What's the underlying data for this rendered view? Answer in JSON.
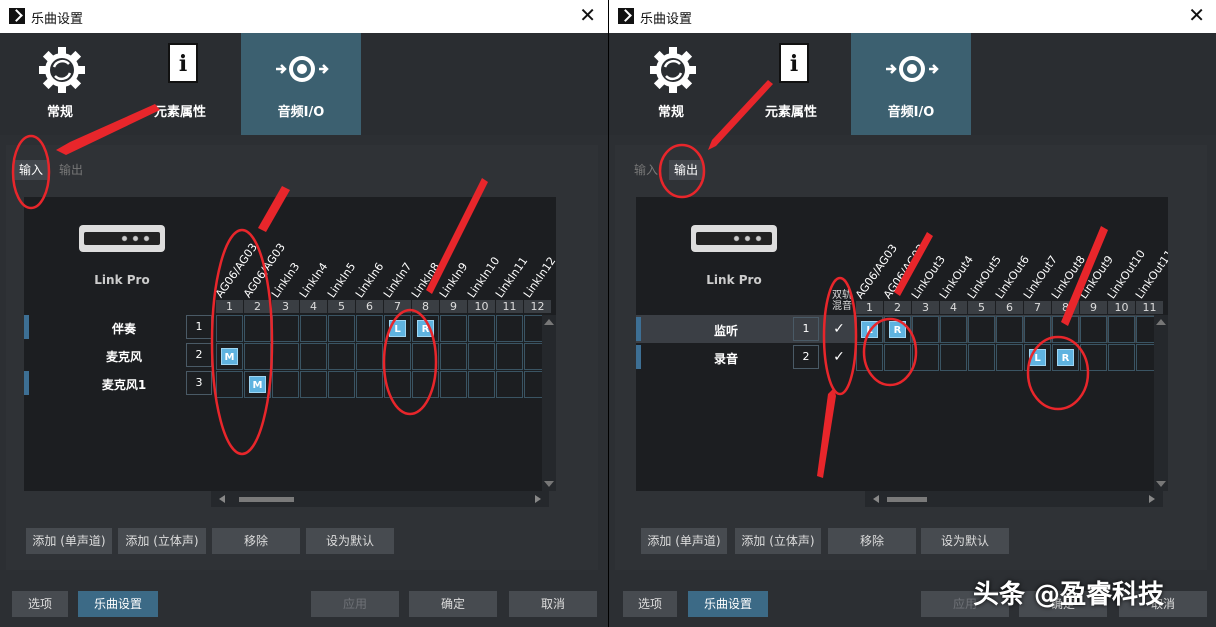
{
  "watermark": "头条 @盈睿科技",
  "left": {
    "title": "乐曲设置",
    "tabs": {
      "general": "常规",
      "properties": "元素属性",
      "audio_io": "音频I/O"
    },
    "subtabs": [
      "输入",
      "输出"
    ],
    "device": "Link Pro",
    "columns": [
      "AG06/AG03",
      "AG06/AG03",
      "LinkIn3",
      "LinkIn4",
      "LinkIn5",
      "LinkIn6",
      "LinkIn7",
      "LinkIn8",
      "LinkIn9",
      "LinkIn10",
      "LinkIn11",
      "LinkIn12"
    ],
    "col_numbers": [
      "1",
      "2",
      "3",
      "4",
      "5",
      "6",
      "7",
      "8",
      "9",
      "10",
      "11",
      "12"
    ],
    "rows": [
      {
        "label": "伴奏",
        "num": "1"
      },
      {
        "label": "麦克风",
        "num": "2"
      },
      {
        "label": "麦克风1",
        "num": "3"
      }
    ],
    "badges": {
      "L": "L",
      "R": "R",
      "M": "M"
    },
    "buttons": [
      "添加 (单声道)",
      "添加 (立体声)",
      "移除",
      "设为默认"
    ],
    "footer": {
      "options": "选项",
      "song_settings": "乐曲设置",
      "apply": "应用",
      "ok": "确定",
      "cancel": "取消"
    }
  },
  "right": {
    "title": "乐曲设置",
    "tabs": {
      "general": "常规",
      "properties": "元素属性",
      "audio_io": "音频I/O"
    },
    "subtabs": [
      "输入",
      "输出"
    ],
    "device": "Link Pro",
    "dual_label": "双轨混音",
    "columns": [
      "AG06/AG03",
      "AG06/AG03",
      "LinkOut3",
      "LinkOut4",
      "LinkOut5",
      "LinkOut6",
      "LinkOut7",
      "LinkOut8",
      "LinkOut9",
      "LinkOut10",
      "LinkOut11"
    ],
    "col_numbers": [
      "1",
      "2",
      "3",
      "4",
      "5",
      "6",
      "7",
      "8",
      "9",
      "10",
      "11"
    ],
    "rows": [
      {
        "label": "监听",
        "num": "1"
      },
      {
        "label": "录音",
        "num": "2"
      }
    ],
    "checkmark": "✓",
    "badges": {
      "L": "L",
      "R": "R"
    },
    "buttons": [
      "添加 (单声道)",
      "添加 (立体声)",
      "移除",
      "设为默认"
    ],
    "footer": {
      "options": "选项",
      "song_settings": "乐曲设置",
      "apply": "应用",
      "ok": "确定",
      "cancel": "取消"
    }
  },
  "colors": {
    "accent": "#3c6070",
    "badge": "#5fb3e0",
    "annotation": "#e8262b"
  }
}
